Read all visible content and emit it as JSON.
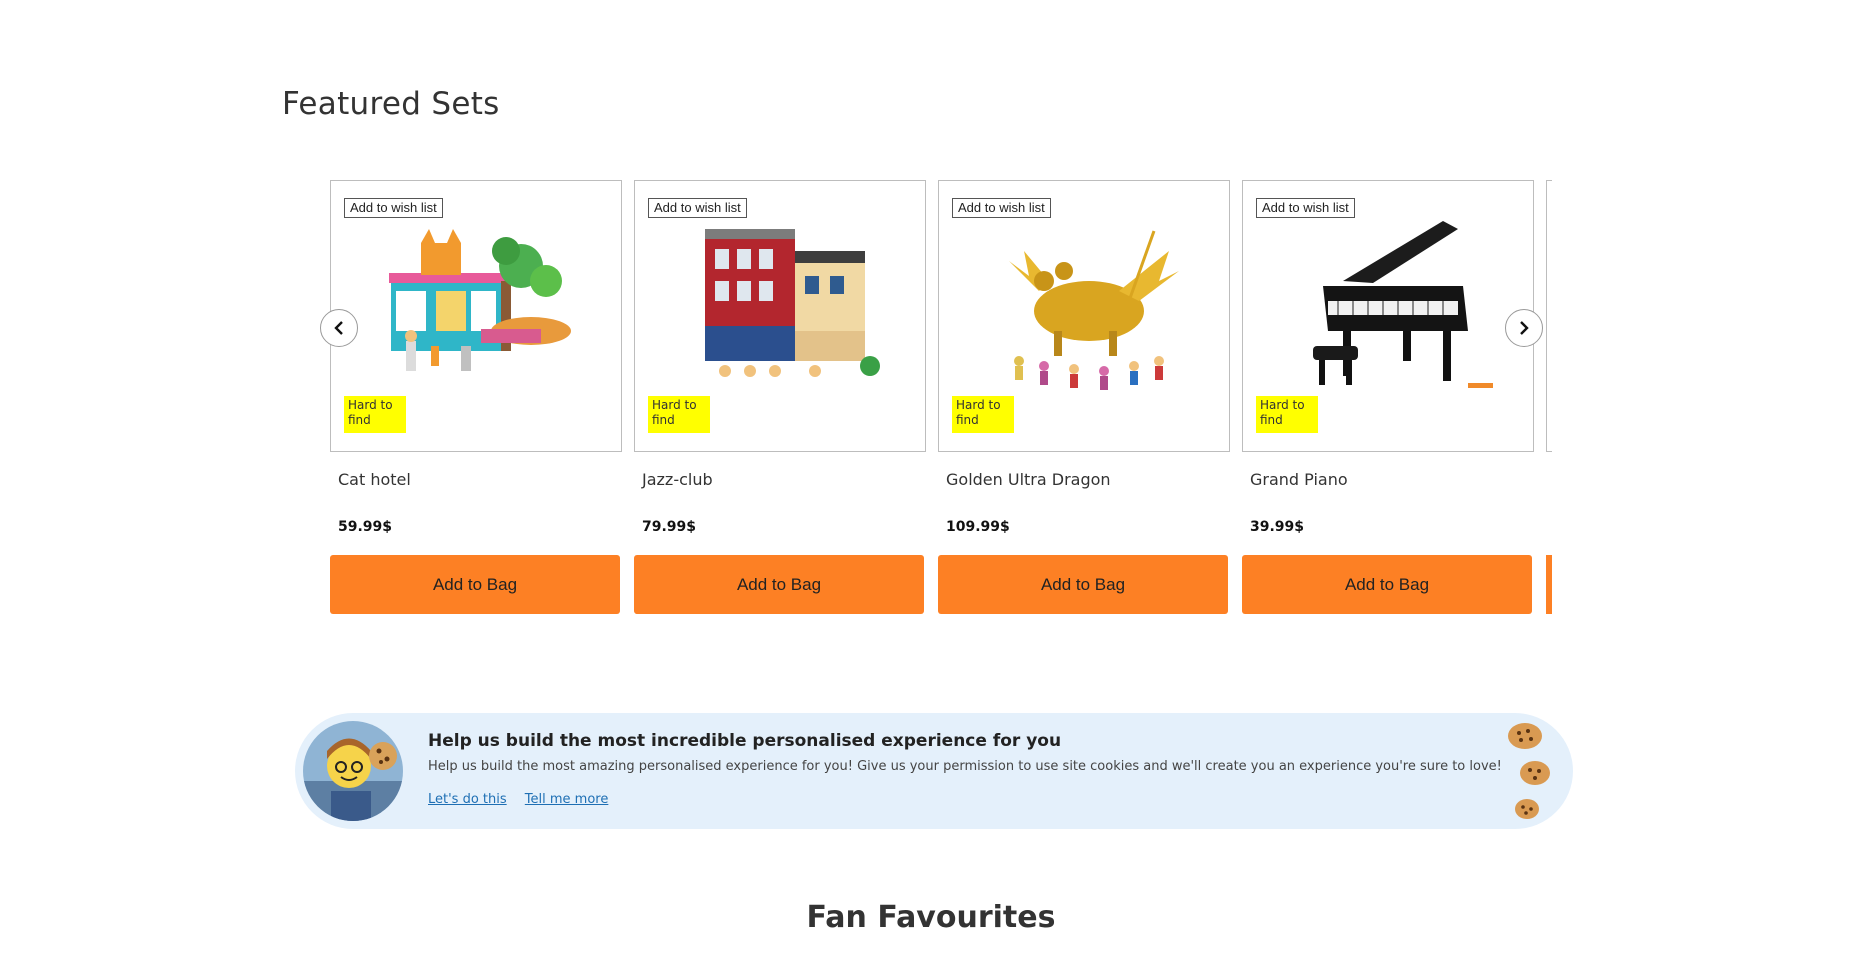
{
  "featured": {
    "title": "Featured Sets",
    "wish_label": "Add to wish list",
    "badge_label": "Hard to find",
    "add_label": "Add to Bag",
    "products": [
      {
        "name": "Cat hotel",
        "price": "59.99$"
      },
      {
        "name": "Jazz-club",
        "price": "79.99$"
      },
      {
        "name": "Golden Ultra Dragon",
        "price": "109.99$"
      },
      {
        "name": "Grand Piano",
        "price": "39.99$"
      }
    ]
  },
  "carousel": {
    "prev_icon": "chevron-left-icon",
    "next_icon": "chevron-right-icon"
  },
  "cookie": {
    "title": "Help us build the most incredible personalised experience for you",
    "text": "Help us build the most amazing personalised experience for you! Give us your permission to use site cookies and we'll create you an experience you're sure to love!",
    "accept_link": "Let's do this",
    "more_link": "Tell me more"
  },
  "fan": {
    "title": "Fan Favourites"
  },
  "colors": {
    "accent": "#fd8024",
    "badge": "#ffff00",
    "banner_bg": "#e4f0fb",
    "link": "#1e6fb4"
  }
}
